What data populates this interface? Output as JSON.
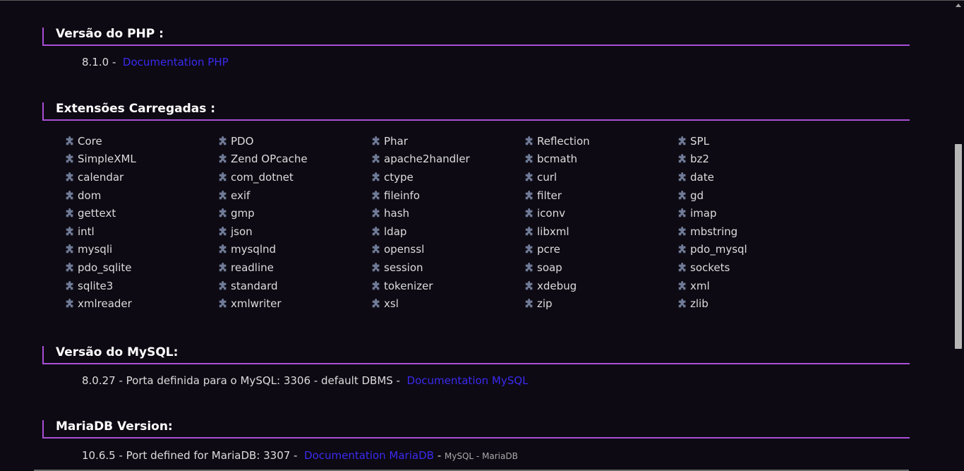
{
  "php": {
    "title": "Versão do PHP :",
    "version": "8.1.0",
    "sep": " - ",
    "doc_link": "Documentation PHP"
  },
  "extensions": {
    "title": "Extensões Carregadas :",
    "icon": "puzzle-piece-icon",
    "columns": [
      [
        "Core",
        "SimpleXML",
        "calendar",
        "dom",
        "gettext",
        "intl",
        "mysqli",
        "pdo_sqlite",
        "sqlite3",
        "xmlreader"
      ],
      [
        "PDO",
        "Zend OPcache",
        "com_dotnet",
        "exif",
        "gmp",
        "json",
        "mysqlnd",
        "readline",
        "standard",
        "xmlwriter"
      ],
      [
        "Phar",
        "apache2handler",
        "ctype",
        "fileinfo",
        "hash",
        "ldap",
        "openssl",
        "session",
        "tokenizer",
        "xsl"
      ],
      [
        "Reflection",
        "bcmath",
        "curl",
        "filter",
        "iconv",
        "libxml",
        "pcre",
        "soap",
        "xdebug",
        "zip"
      ],
      [
        "SPL",
        "bz2",
        "date",
        "gd",
        "imap",
        "mbstring",
        "pdo_mysql",
        "sockets",
        "xml",
        "zlib"
      ]
    ]
  },
  "mysql": {
    "title": "Versão do MySQL:",
    "text": "8.0.27 - Porta definida para o MySQL: 3306 - default DBMS - ",
    "doc_link": "Documentation MySQL"
  },
  "mariadb": {
    "title": "MariaDB Version:",
    "text": "10.6.5 - Port defined for MariaDB: 3307 - ",
    "doc_link": "Documentation MariaDB",
    "sep": " - ",
    "note": "MySQL - MariaDB"
  },
  "colors": {
    "background": "#0d0a13",
    "accent": "#a94fd6",
    "link": "#3b2af0",
    "text": "#dcdcdc"
  }
}
